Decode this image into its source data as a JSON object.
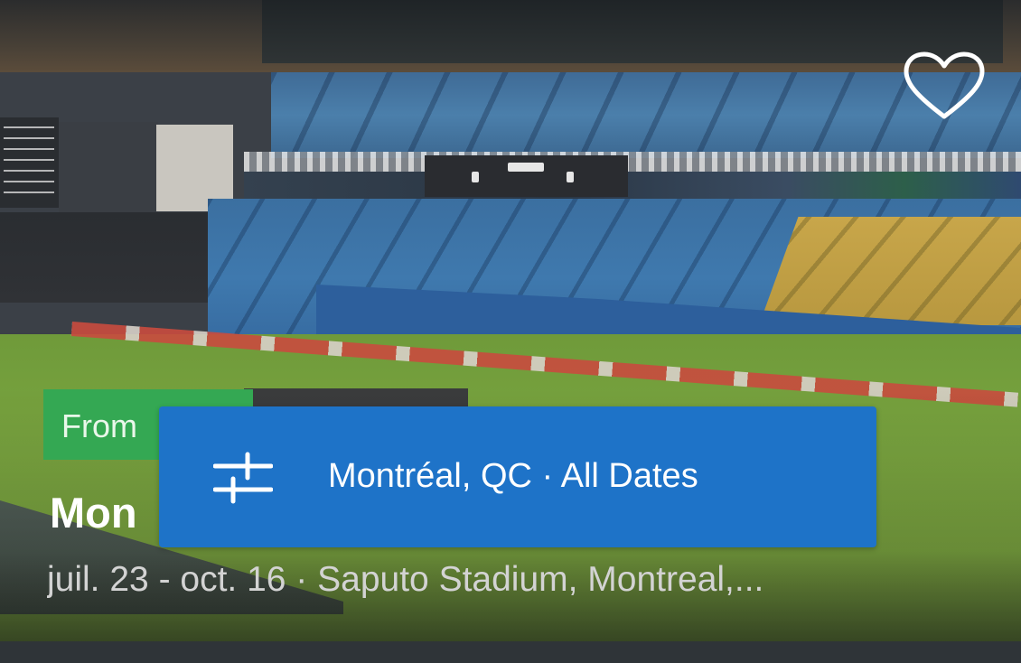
{
  "card": {
    "price_badge": "From",
    "title": "Mon",
    "subtitle": "juil. 23 - oct. 16 · Saputo Stadium, Montreal,..."
  },
  "filter_bar": {
    "label": "Montréal, QC · All Dates",
    "icon": "sliders-icon"
  },
  "favorite": {
    "icon": "heart-outline-icon"
  },
  "colors": {
    "filter_bar_bg": "#1e73c8",
    "price_badge_bg": "#34a853",
    "text_primary": "#ffffff",
    "text_secondary": "#d3d3d3"
  }
}
